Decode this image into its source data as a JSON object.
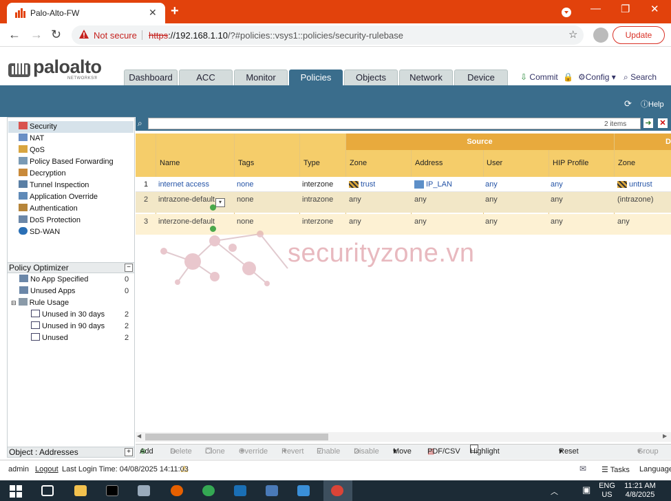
{
  "browser": {
    "tab_title": "Palo-Alto-FW",
    "not_secure": "Not secure",
    "url_scheme": "https",
    "url_host": "://192.168.1.10",
    "url_path": "/?#policies::vsys1::policies/security-rulebase",
    "update_label": "Update"
  },
  "brand": {
    "logo_text": "paloalto",
    "logo_sub": "NETWORKS®"
  },
  "nav_tabs": [
    "Dashboard",
    "ACC",
    "Monitor",
    "Policies",
    "Objects",
    "Network",
    "Device"
  ],
  "active_tab": "Policies",
  "header_links": {
    "commit": "Commit",
    "config": "Config",
    "search": "Search"
  },
  "help": {
    "label": "Help"
  },
  "sidebar": {
    "items": [
      {
        "label": "Security"
      },
      {
        "label": "NAT"
      },
      {
        "label": "QoS"
      },
      {
        "label": "Policy Based Forwarding"
      },
      {
        "label": "Decryption"
      },
      {
        "label": "Tunnel Inspection"
      },
      {
        "label": "Application Override"
      },
      {
        "label": "Authentication"
      },
      {
        "label": "DoS Protection"
      },
      {
        "label": "SD-WAN"
      }
    ]
  },
  "optimizer": {
    "title": "Policy Optimizer",
    "items": [
      {
        "label": "No App Specified",
        "count": "0"
      },
      {
        "label": "Unused Apps",
        "count": "0"
      },
      {
        "label": "Rule Usage",
        "count": ""
      },
      {
        "label": "Unused in 30 days",
        "count": "2"
      },
      {
        "label": "Unused in 90 days",
        "count": "2"
      },
      {
        "label": "Unused",
        "count": "2"
      }
    ]
  },
  "object_panel": {
    "title": "Object : Addresses"
  },
  "search": {
    "items_count": "2 items"
  },
  "table": {
    "group_source": "Source",
    "group_dest": "D",
    "headers": [
      "Name",
      "Tags",
      "Type",
      "Zone",
      "Address",
      "User",
      "HIP Profile",
      "Zone"
    ],
    "rows": [
      {
        "num": "1",
        "name": "internet access",
        "tags": "none",
        "type": "interzone",
        "src_zone": "trust",
        "src_addr": "IP_LAN",
        "user": "any",
        "hip": "any",
        "dst_zone": "untrust"
      },
      {
        "num": "2",
        "name": "intrazone-default",
        "tags": "none",
        "type": "intrazone",
        "src_zone": "any",
        "src_addr": "any",
        "user": "any",
        "hip": "any",
        "dst_zone": "(intrazone)"
      },
      {
        "num": "3",
        "name": "interzone-default",
        "tags": "none",
        "type": "interzone",
        "src_zone": "any",
        "src_addr": "any",
        "user": "any",
        "hip": "any",
        "dst_zone": "any"
      }
    ]
  },
  "watermark": "securityzone.vn",
  "bottom_toolbar": {
    "add": "Add",
    "delete": "Delete",
    "clone": "Clone",
    "override": "Override",
    "revert": "Revert",
    "enable": "Enable",
    "disable": "Disable",
    "move": "Move",
    "pdf": "PDF/CSV",
    "highlight": "Highlight Unused Rules",
    "reset": "Reset Rule Hit Counter",
    "group": "Group"
  },
  "status": {
    "user": "admin",
    "logout": "Logout",
    "last_login": "Last Login Time: 04/08/2025 14:11:03",
    "tasks": "Tasks",
    "language": "Language"
  },
  "taskbar": {
    "lang1": "ENG",
    "lang2": "US",
    "time": "11:21 AM",
    "date": "4/8/2025"
  },
  "colors": {
    "accent": "#3a6d8c",
    "header_gold": "#f5cd6a",
    "source_band": "#e8aa3d",
    "chrome_red": "#e2420c"
  }
}
